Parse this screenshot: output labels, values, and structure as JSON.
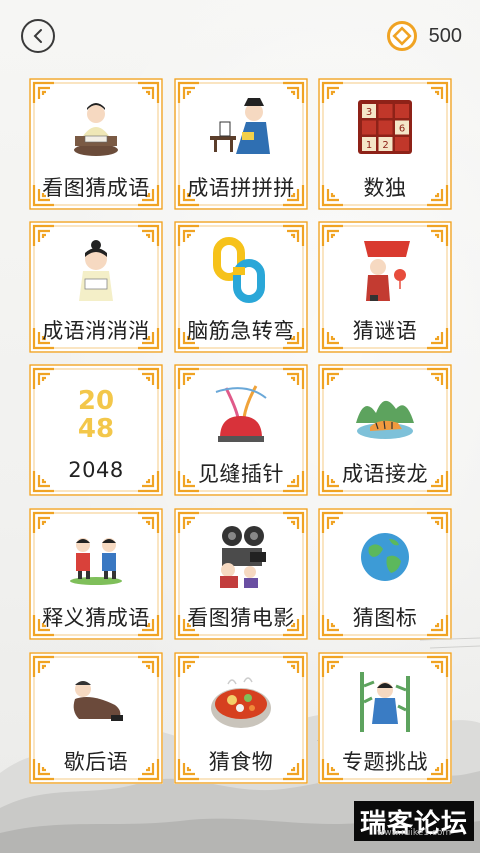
{
  "header": {
    "back_icon": "chevron-left-icon",
    "coin_icon": "coin-icon",
    "coin_count": "500"
  },
  "colors": {
    "frame": "#f0a323",
    "accent_text": "#222222",
    "coin": "#f0a323"
  },
  "games": [
    {
      "label": "看图猜成语",
      "icon": "scholar-reading-icon"
    },
    {
      "label": "成语拼拼拼",
      "icon": "scholar-desk-icon"
    },
    {
      "label": "数独",
      "icon": "sudoku-icon",
      "digits": [
        "3",
        "6",
        "1",
        "2"
      ]
    },
    {
      "label": "成语消消消",
      "icon": "child-scholar-icon"
    },
    {
      "label": "脑筋急转弯",
      "icon": "chain-links-icon"
    },
    {
      "label": "猜谜语",
      "icon": "lantern-riddle-icon"
    },
    {
      "label": "2048",
      "icon": "number-2048-icon",
      "art_text": [
        "20",
        "48"
      ]
    },
    {
      "label": "见缝插针",
      "icon": "pincushion-icon"
    },
    {
      "label": "成语接龙",
      "icon": "tiger-landscape-icon"
    },
    {
      "label": "释义猜成语",
      "icon": "two-children-icon"
    },
    {
      "label": "看图猜电影",
      "icon": "film-projector-icon"
    },
    {
      "label": "猜图标",
      "icon": "globe-icon"
    },
    {
      "label": "歇后语",
      "icon": "reclining-monk-icon"
    },
    {
      "label": "猜食物",
      "icon": "hotpot-icon"
    },
    {
      "label": "专题挑战",
      "icon": "bamboo-child-icon"
    }
  ],
  "watermark": {
    "text": "瑞客论坛",
    "sub": "www.ruike1.com"
  }
}
